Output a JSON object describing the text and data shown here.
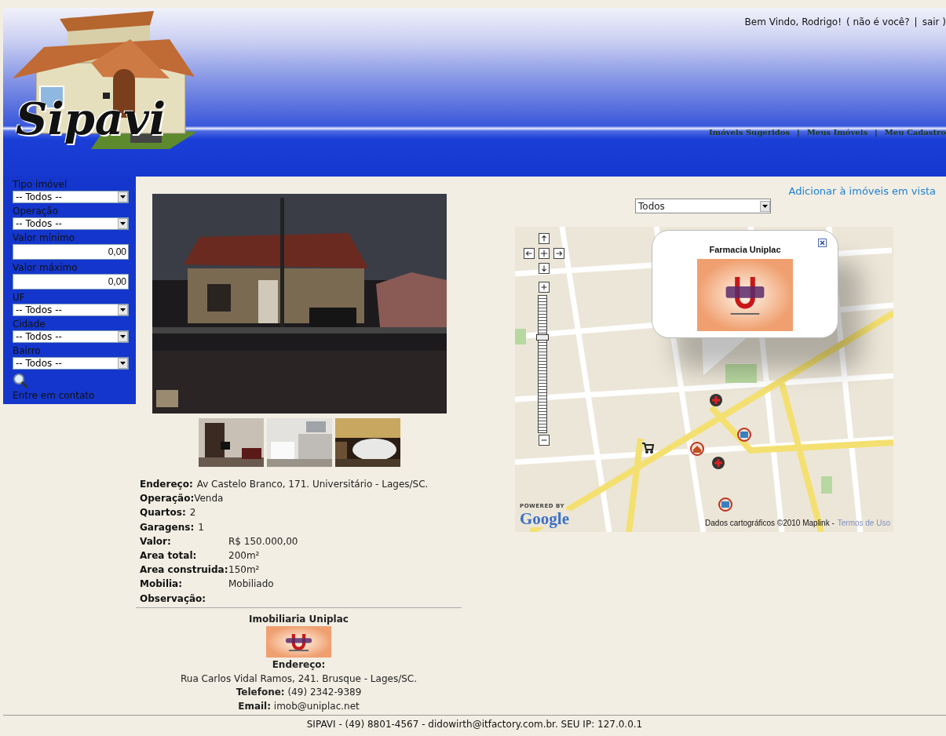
{
  "header": {
    "logo_text": "Sipavi",
    "welcome": "Bem Vindo, Rodrigo!",
    "user_links": [
      {
        "label": "( não é você?"
      },
      {
        "label": "sair )"
      }
    ],
    "user_separator": "|",
    "nav": [
      {
        "label": "Imóveis Sugeridos"
      },
      {
        "label": "Meus Imóveis"
      },
      {
        "label": "Meu Cadastro"
      }
    ],
    "nav_separator": "|"
  },
  "sidebar": {
    "filters": [
      {
        "label": "Tipo imóvel",
        "kind": "select",
        "value": "-- Todos --"
      },
      {
        "label": "Operação",
        "kind": "select",
        "value": "-- Todos --"
      },
      {
        "label": "Valor mínimo",
        "kind": "input",
        "value": "0,00"
      },
      {
        "label": "Valor máximo",
        "kind": "input",
        "value": "0,00"
      },
      {
        "label": "UF",
        "kind": "select",
        "value": "-- Todos --"
      },
      {
        "label": "Cidade",
        "kind": "select",
        "value": "-- Todos --"
      },
      {
        "label": "Bairro",
        "kind": "select",
        "value": "-- Todos --"
      }
    ],
    "contact_link": "Entre em contato"
  },
  "property": {
    "details": [
      {
        "label": "Endereço:",
        "value": "Av Castelo Branco, 171. Universitário - Lages/SC.",
        "kind": "inline"
      },
      {
        "label": "Operação:",
        "value": "Venda",
        "kind": "tight"
      },
      {
        "label": "Quartos:",
        "value": "2",
        "kind": "inline"
      },
      {
        "label": "Garagens:",
        "value": "1",
        "kind": "inline"
      },
      {
        "label": "Valor:",
        "value": "R$ 150.000,00",
        "kind": "column"
      },
      {
        "label": "Area total:",
        "value": "200m²",
        "kind": "column"
      },
      {
        "label": "Area construida:",
        "value": "150m²",
        "kind": "column"
      },
      {
        "label": "Mobilia:",
        "value": "Mobiliado",
        "kind": "column"
      },
      {
        "label": "Observação:",
        "kind": "column"
      }
    ]
  },
  "agency": {
    "name": "Imobiliaria Uniplac",
    "address_label": "Endereço:",
    "address": "Rua Carlos Vidal Ramos, 241. Brusque - Lages/SC.",
    "contacts": [
      {
        "label": "Telefone:",
        "value": "(49) 2342-9389"
      },
      {
        "label": "Email:",
        "value": "imob@uniplac.net"
      }
    ]
  },
  "map_panel": {
    "add_link": "Adicionar à imóveis em vista",
    "category_select": "Todos",
    "map": {
      "popup_title": "Farmacia Uniplac",
      "zoom_slider": {
        "level": 0.71
      },
      "powered_by": "POWERED BY",
      "google": "Google",
      "attribution": "Dados cartográficos ©2010 Maplink -",
      "terms_link": "Termos de Uso"
    }
  },
  "footer": "SIPAVI - (49) 8801-4567 - didowirth@itfactory.com.br. SEU IP: 127.0.0.1"
}
